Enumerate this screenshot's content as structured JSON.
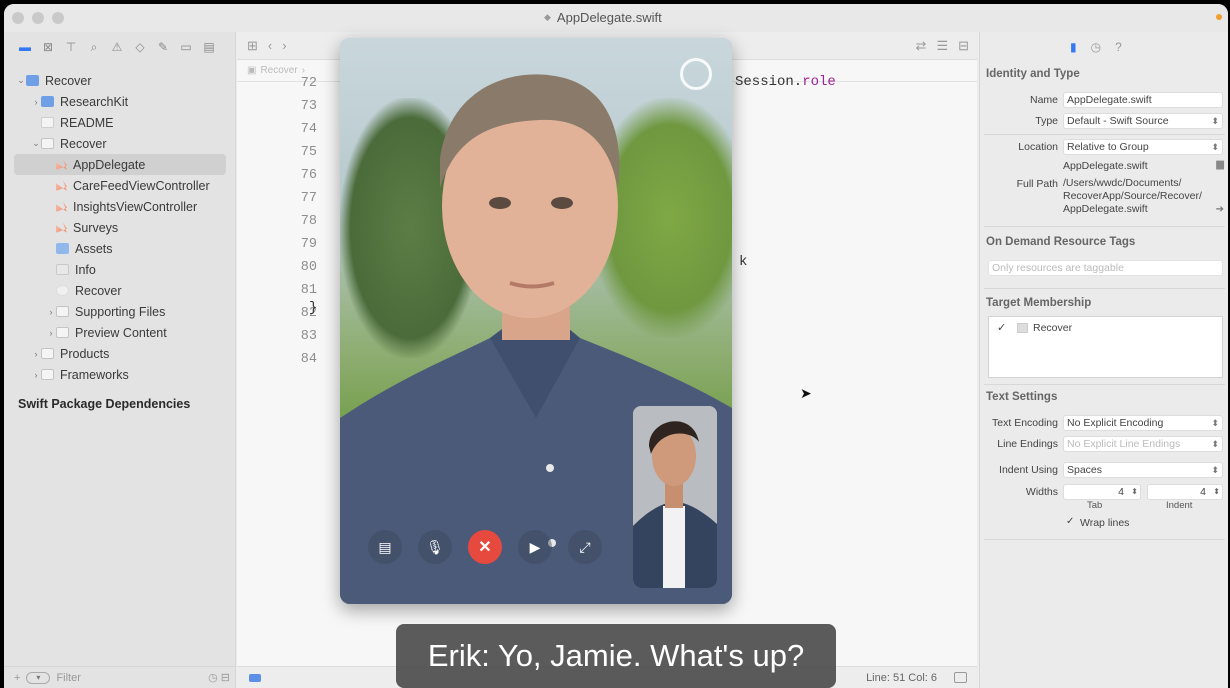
{
  "window": {
    "title": "AppDelegate.swift"
  },
  "navigator": {
    "items": [
      {
        "label": "Recover",
        "indent": 0,
        "chevron": "v",
        "icon": "proj"
      },
      {
        "label": "ResearchKit",
        "indent": 1,
        "chevron": ">",
        "icon": "proj"
      },
      {
        "label": "README",
        "indent": 1,
        "chevron": "",
        "icon": "doc"
      },
      {
        "label": "Recover",
        "indent": 1,
        "chevron": "v",
        "icon": "folder"
      },
      {
        "label": "AppDelegate",
        "indent": 2,
        "chevron": "",
        "icon": "swift",
        "selected": true
      },
      {
        "label": "CareFeedViewController",
        "indent": 2,
        "chevron": "",
        "icon": "swift"
      },
      {
        "label": "InsightsViewController",
        "indent": 2,
        "chevron": "",
        "icon": "swift"
      },
      {
        "label": "Surveys",
        "indent": 2,
        "chevron": "",
        "icon": "swift"
      },
      {
        "label": "Assets",
        "indent": 2,
        "chevron": "",
        "icon": "assets"
      },
      {
        "label": "Info",
        "indent": 2,
        "chevron": "",
        "icon": "info"
      },
      {
        "label": "Recover",
        "indent": 2,
        "chevron": "",
        "icon": "gear"
      },
      {
        "label": "Supporting Files",
        "indent": 2,
        "chevron": ">",
        "icon": "folder"
      },
      {
        "label": "Preview Content",
        "indent": 2,
        "chevron": ">",
        "icon": "folder"
      },
      {
        "label": "Products",
        "indent": 1,
        "chevron": ">",
        "icon": "folder"
      },
      {
        "label": "Frameworks",
        "indent": 1,
        "chevron": ">",
        "icon": "folder"
      }
    ],
    "section": "Swift Package Dependencies",
    "filter_placeholder": "Filter"
  },
  "editor": {
    "breadcrumb": "Recover",
    "line_numbers": [
      "72",
      "73",
      "74",
      "75",
      "76",
      "77",
      "78",
      "79",
      "80",
      "81",
      "82",
      "83",
      "84"
    ],
    "code_fragment_1": "Session.",
    "code_fragment_1_kw": "role",
    "code_fragment_2": "k",
    "code_brace": "}",
    "status": "Line: 51  Col: 6"
  },
  "inspector": {
    "identity_title": "Identity and Type",
    "name_label": "Name",
    "name_value": "AppDelegate.swift",
    "type_label": "Type",
    "type_value": "Default - Swift Source",
    "location_label": "Location",
    "location_value": "Relative to Group",
    "location_file": "AppDelegate.swift",
    "fullpath_label": "Full Path",
    "fullpath_1": "/Users/wwdc/Documents/",
    "fullpath_2": "RecoverApp/Source/Recover/",
    "fullpath_3": "AppDelegate.swift",
    "odr_title": "On Demand Resource Tags",
    "odr_placeholder": "Only resources are taggable",
    "target_title": "Target Membership",
    "target_item": "Recover",
    "text_title": "Text Settings",
    "encoding_label": "Text Encoding",
    "encoding_value": "No Explicit Encoding",
    "endings_label": "Line Endings",
    "endings_value": "No Explicit Line Endings",
    "indent_label": "Indent Using",
    "indent_value": "Spaces",
    "widths_label": "Widths",
    "tab_value": "4",
    "indent_width_value": "4",
    "tab_caption": "Tab",
    "indent_caption": "Indent",
    "wrap_label": "Wrap lines"
  },
  "facetime": {
    "end_icon": "✕"
  },
  "caption": "Erik: Yo, Jamie. What's up?"
}
